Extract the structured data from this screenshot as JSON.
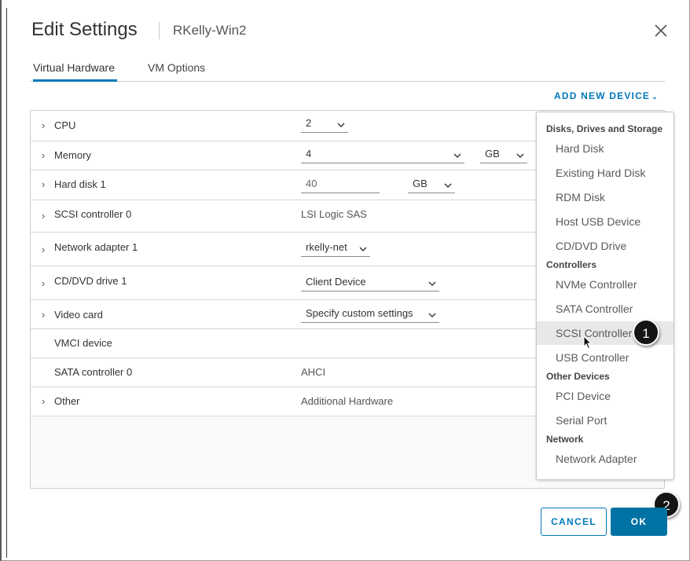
{
  "window": {
    "title": "Edit Settings",
    "subtitle": "RKelly-Win2"
  },
  "tabs": [
    {
      "label": "Virtual Hardware",
      "active": true
    },
    {
      "label": "VM Options",
      "active": false
    }
  ],
  "add_device_label": "ADD NEW DEVICE",
  "hardware": {
    "cpu": {
      "label": "CPU",
      "value": "2"
    },
    "memory": {
      "label": "Memory",
      "value": "4",
      "unit": "GB"
    },
    "hard_disk": {
      "label": "Hard disk 1",
      "value": "40",
      "unit": "GB"
    },
    "scsi": {
      "label": "SCSI controller 0",
      "value": "LSI Logic SAS"
    },
    "network": {
      "label": "Network adapter 1",
      "value": "rkelly-net"
    },
    "cddvd": {
      "label": "CD/DVD drive 1",
      "value": "Client Device"
    },
    "video": {
      "label": "Video card",
      "value": "Specify custom settings"
    },
    "vmci": {
      "label": "VMCI device"
    },
    "sata": {
      "label": "SATA controller 0",
      "value": "AHCI"
    },
    "other": {
      "label": "Other",
      "value": "Additional Hardware"
    }
  },
  "add_device_menu": {
    "groups": [
      {
        "header": "Disks, Drives and Storage",
        "items": [
          "Hard Disk",
          "Existing Hard Disk",
          "RDM Disk",
          "Host USB Device",
          "CD/DVD Drive"
        ]
      },
      {
        "header": "Controllers",
        "items": [
          "NVMe Controller",
          "SATA Controller",
          "SCSI Controller",
          "USB Controller"
        ]
      },
      {
        "header": "Other Devices",
        "items": [
          "PCI Device",
          "Serial Port"
        ]
      },
      {
        "header": "Network",
        "items": [
          "Network Adapter"
        ]
      }
    ],
    "hovered_item": "SCSI Controller"
  },
  "callouts": [
    "1",
    "2"
  ],
  "buttons": {
    "cancel": "CANCEL",
    "ok": "OK"
  },
  "colors": {
    "accent": "#0079b8",
    "ok_bg": "#0072a3",
    "badge": "#151515"
  }
}
